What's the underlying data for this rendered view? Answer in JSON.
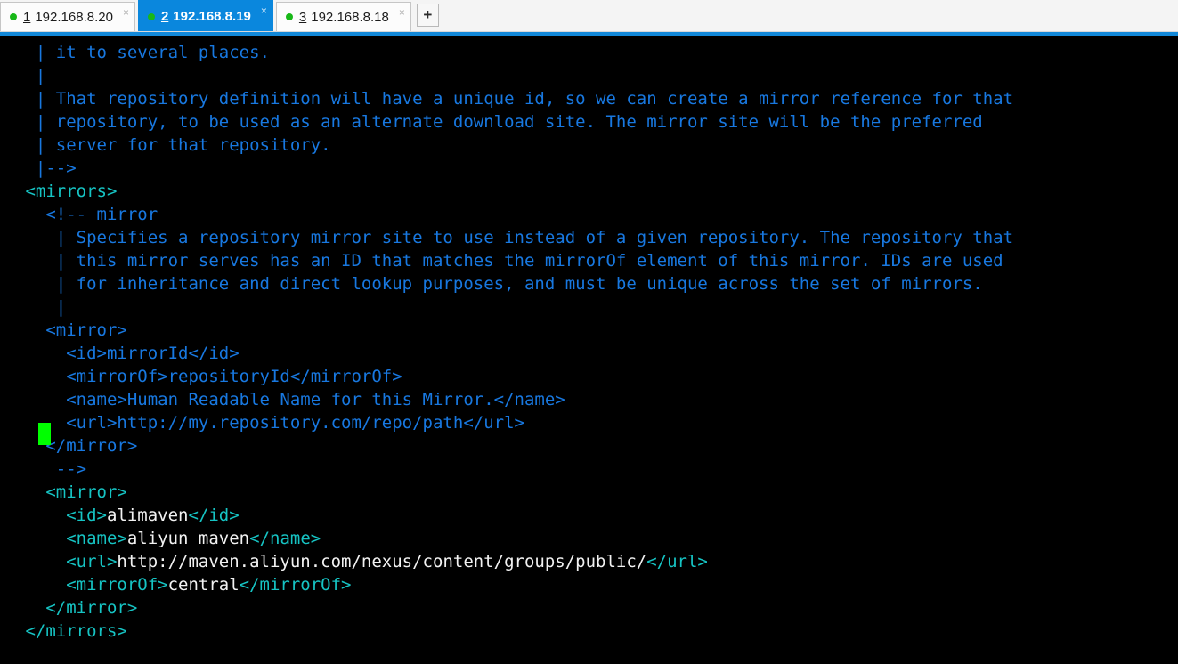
{
  "tabs": [
    {
      "index": "1",
      "address": "192.168.8.20",
      "status_dot": "connected-dot",
      "close": "×",
      "active": false
    },
    {
      "index": "2",
      "address": "192.168.8.19",
      "status_dot": "connected-dot",
      "close": "×",
      "active": true
    },
    {
      "index": "3",
      "address": "192.168.8.18",
      "status_dot": "connected-dot",
      "close": "×",
      "active": false
    }
  ],
  "new_tab_label": "+",
  "colors": {
    "active_tab_bg": "#0a87dd",
    "tabbar_bg": "#f4f4f4",
    "rule": "#1288d8",
    "terminal_bg": "#000000",
    "comment": "#1878e0",
    "tag": "#16c4c4",
    "text": "#f2f2f2",
    "cursor": "#00ff00",
    "status_dot": "#18b818"
  },
  "terminal": {
    "cursor": {
      "visible": true,
      "column": 2,
      "line": 16
    },
    "lines": [
      {
        "n": 1,
        "segments": [
          {
            "style": "cmt",
            "text": "  | it to several places."
          }
        ]
      },
      {
        "n": 2,
        "segments": [
          {
            "style": "cmt",
            "text": "  |"
          }
        ]
      },
      {
        "n": 3,
        "segments": [
          {
            "style": "cmt",
            "text": "  | That repository definition will have a unique id, so we can create a mirror reference for that"
          }
        ]
      },
      {
        "n": 4,
        "segments": [
          {
            "style": "cmt",
            "text": "  | repository, to be used as an alternate download site. The mirror site will be the preferred"
          }
        ]
      },
      {
        "n": 5,
        "segments": [
          {
            "style": "cmt",
            "text": "  | server for that repository."
          }
        ]
      },
      {
        "n": 6,
        "segments": [
          {
            "style": "cmt",
            "text": "  |-->"
          }
        ]
      },
      {
        "n": 7,
        "segments": [
          {
            "style": "tag",
            "text": " <mirrors>"
          }
        ]
      },
      {
        "n": 8,
        "segments": [
          {
            "style": "cmt",
            "text": "   <!-- mirror"
          }
        ]
      },
      {
        "n": 9,
        "segments": [
          {
            "style": "cmt",
            "text": "    | Specifies a repository mirror site to use instead of a given repository. The repository that"
          }
        ]
      },
      {
        "n": 10,
        "segments": [
          {
            "style": "cmt",
            "text": "    | this mirror serves has an ID that matches the mirrorOf element of this mirror. IDs are used"
          }
        ]
      },
      {
        "n": 11,
        "segments": [
          {
            "style": "cmt",
            "text": "    | for inheritance and direct lookup purposes, and must be unique across the set of mirrors."
          }
        ]
      },
      {
        "n": 12,
        "segments": [
          {
            "style": "cmt",
            "text": "    |"
          }
        ]
      },
      {
        "n": 13,
        "segments": [
          {
            "style": "cmt",
            "text": "   <mirror>"
          }
        ]
      },
      {
        "n": 14,
        "segments": [
          {
            "style": "cmt",
            "text": "     <id>mirrorId</id>"
          }
        ]
      },
      {
        "n": 15,
        "segments": [
          {
            "style": "cmt",
            "text": "     <mirrorOf>repositoryId</mirrorOf>"
          }
        ]
      },
      {
        "n": 16,
        "segments": [
          {
            "style": "cmt",
            "text": "     <name>Human Readable Name for this Mirror.</name>"
          }
        ]
      },
      {
        "n": 17,
        "segments": [
          {
            "style": "cmt",
            "text": "     <url>http://my.repository.com/repo/path</url>"
          }
        ]
      },
      {
        "n": 18,
        "segments": [
          {
            "style": "cmt",
            "text": "   </mirror>"
          }
        ]
      },
      {
        "n": 19,
        "segments": [
          {
            "style": "cmt",
            "text": "    -->"
          }
        ]
      },
      {
        "n": 20,
        "segments": [
          {
            "style": "tag",
            "text": "   <mirror>"
          }
        ]
      },
      {
        "n": 21,
        "segments": [
          {
            "style": "tag",
            "text": "     <id>"
          },
          {
            "style": "txt",
            "text": "alimaven"
          },
          {
            "style": "tag",
            "text": "</id>"
          }
        ]
      },
      {
        "n": 22,
        "segments": [
          {
            "style": "tag",
            "text": "     <name>"
          },
          {
            "style": "txt",
            "text": "aliyun maven"
          },
          {
            "style": "tag",
            "text": "</name>"
          }
        ]
      },
      {
        "n": 23,
        "segments": [
          {
            "style": "tag",
            "text": "     <url>"
          },
          {
            "style": "txt",
            "text": "http://maven.aliyun.com/nexus/content/groups/public/"
          },
          {
            "style": "tag",
            "text": "</url>"
          }
        ]
      },
      {
        "n": 24,
        "segments": [
          {
            "style": "tag",
            "text": "     <mirrorOf>"
          },
          {
            "style": "txt",
            "text": "central"
          },
          {
            "style": "tag",
            "text": "</mirrorOf>"
          }
        ]
      },
      {
        "n": 25,
        "segments": [
          {
            "style": "tag",
            "text": "   </mirror>"
          }
        ]
      },
      {
        "n": 26,
        "segments": [
          {
            "style": "tag",
            "text": " </mirrors>"
          }
        ]
      }
    ]
  }
}
